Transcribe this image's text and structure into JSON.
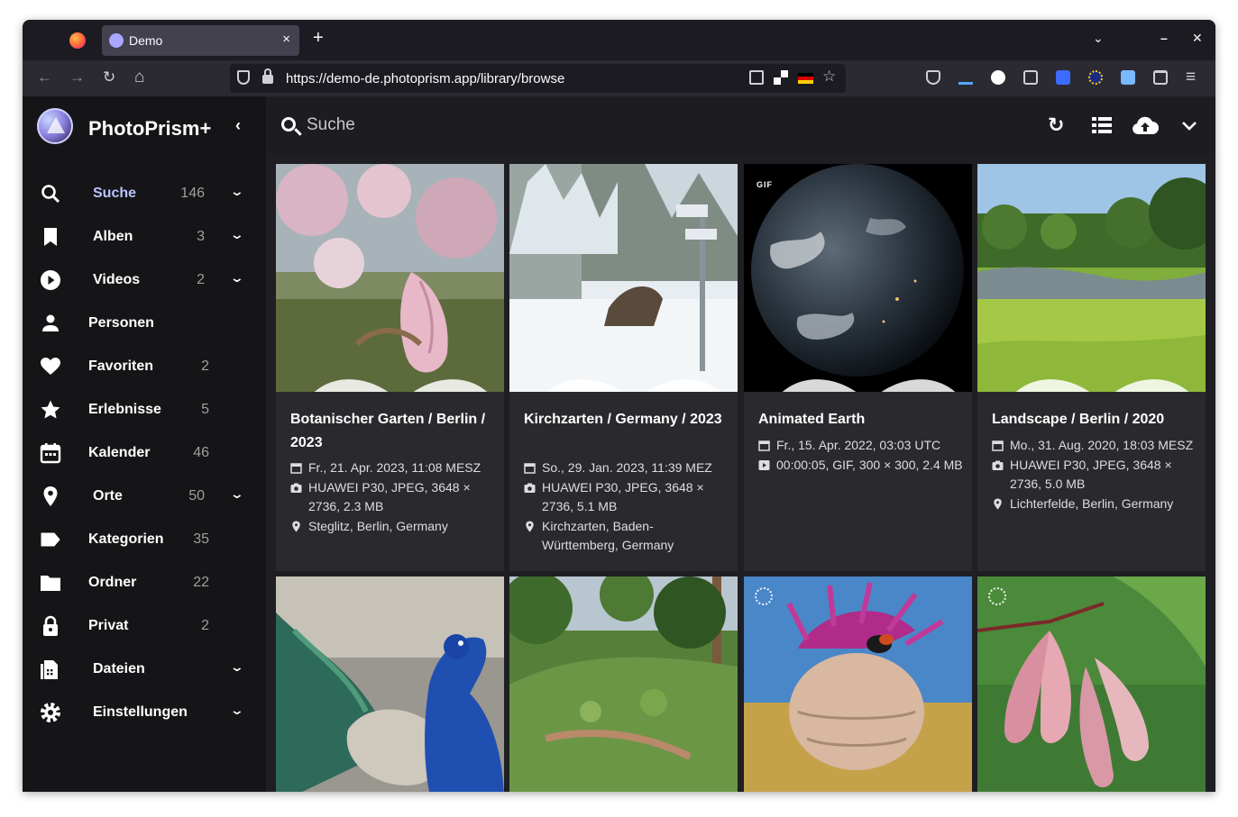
{
  "browser": {
    "tab_title": "Demo",
    "tab_close": "×",
    "new_tab": "+",
    "tablist": "⌄",
    "minimize": "–",
    "close": "✕",
    "back": "←",
    "forward": "→",
    "reload": "↻",
    "home": "⌂",
    "url": "https://demo-de.photoprism.app/library/browse",
    "bookmark": "☆",
    "menu": "≡"
  },
  "app": {
    "brand": "PhotoPrism+",
    "collapse": "‹",
    "search_placeholder": "Suche",
    "toolbar": {
      "reload": "↻",
      "list_view": "☰",
      "upload": "☁",
      "expand": "⌄"
    }
  },
  "sidebar": {
    "items": [
      {
        "label": "Suche",
        "count": "146",
        "icon": "search-icon",
        "expandable": true,
        "active": true
      },
      {
        "label": "Alben",
        "count": "3",
        "icon": "bookmark-icon",
        "expandable": true
      },
      {
        "label": "Videos",
        "count": "2",
        "icon": "play-icon",
        "expandable": true
      },
      {
        "label": "Personen",
        "count": "",
        "icon": "person-icon",
        "expandable": false
      },
      {
        "label": "Favoriten",
        "count": "2",
        "icon": "heart-icon",
        "expandable": false
      },
      {
        "label": "Erlebnisse",
        "count": "5",
        "icon": "star-icon",
        "expandable": false
      },
      {
        "label": "Kalender",
        "count": "46",
        "icon": "calendar-icon",
        "expandable": false
      },
      {
        "label": "Orte",
        "count": "50",
        "icon": "location-icon",
        "expandable": true
      },
      {
        "label": "Kategorien",
        "count": "35",
        "icon": "label-icon",
        "expandable": false
      },
      {
        "label": "Ordner",
        "count": "22",
        "icon": "folder-icon",
        "expandable": false
      },
      {
        "label": "Privat",
        "count": "2",
        "icon": "lock-icon",
        "expandable": false
      },
      {
        "label": "Dateien",
        "count": "",
        "icon": "files-icon",
        "expandable": true
      },
      {
        "label": "Einstellungen",
        "count": "",
        "icon": "gear-icon",
        "expandable": true
      }
    ],
    "chevron": "⌄"
  },
  "photos": [
    {
      "title": "Botanischer Garten / Berlin / 2023",
      "date": "Fr., 21. Apr. 2023, 11:08 MESZ",
      "camera": "HUAWEI P30, JPEG, 3648 × 2736, 2.3 MB",
      "location": "Steglitz, Berlin, Germany"
    },
    {
      "title": "Kirchzarten / Germany / 2023",
      "date": "So., 29. Jan. 2023, 11:39 MEZ",
      "camera": "HUAWEI P30, JPEG, 3648 × 2736, 5.1 MB",
      "location": "Kirchzarten, Baden-Württemberg, Germany"
    },
    {
      "title": "Animated Earth",
      "date": "Fr., 15. Apr. 2022, 03:03 UTC",
      "camera": "00:00:05, GIF, 300 × 300, 2.4 MB",
      "badge": "GIF"
    },
    {
      "title": "Landscape / Berlin / 2020",
      "date": "Mo., 31. Aug. 2020, 18:03 MESZ",
      "camera": "HUAWEI P30, JPEG, 3648 × 2736, 5.0 MB",
      "location": "Lichterfelde, Berlin, Germany"
    }
  ]
}
